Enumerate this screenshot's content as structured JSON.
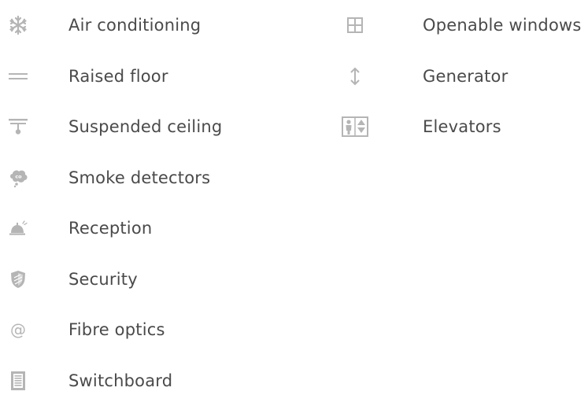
{
  "colors": {
    "text": "#4a4a4a",
    "icon": "#b5b5b5",
    "background": "#ffffff"
  },
  "amenities": {
    "left": [
      {
        "label": "Air conditioning",
        "icon": "snowflake-icon"
      },
      {
        "label": "Raised floor",
        "icon": "raised-floor-icon"
      },
      {
        "label": "Suspended ceiling",
        "icon": "suspended-ceiling-icon"
      },
      {
        "label": "Smoke detectors",
        "icon": "smoke-detector-icon"
      },
      {
        "label": "Reception",
        "icon": "reception-bell-icon"
      },
      {
        "label": "Security",
        "icon": "shield-icon"
      },
      {
        "label": "Fibre optics",
        "icon": "at-sign-icon"
      },
      {
        "label": "Switchboard",
        "icon": "switchboard-icon"
      }
    ],
    "right": [
      {
        "label": "Openable windows",
        "icon": "window-icon"
      },
      {
        "label": "Generator",
        "icon": "up-down-arrow-icon"
      },
      {
        "label": "Elevators",
        "icon": "elevator-icon"
      }
    ]
  }
}
